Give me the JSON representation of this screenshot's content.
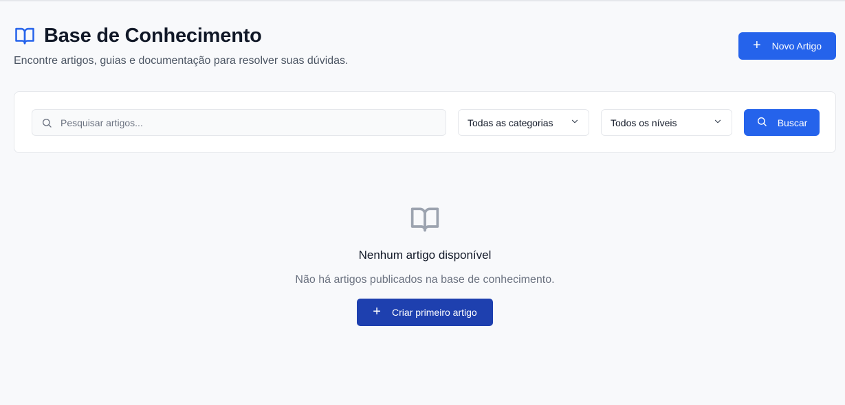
{
  "header": {
    "title": "Base de Conhecimento",
    "subtitle": "Encontre artigos, guias e documentação para resolver suas dúvidas.",
    "icon": "book-open-icon",
    "new_article_label": "Novo Artigo"
  },
  "filters": {
    "search_placeholder": "Pesquisar artigos...",
    "search_value": "",
    "category_selected": "Todas as categorias",
    "level_selected": "Todos os níveis",
    "search_button_label": "Buscar"
  },
  "empty_state": {
    "icon": "book-open-icon",
    "title": "Nenhum artigo disponível",
    "text": "Não há artigos publicados na base de conhecimento.",
    "create_label": "Criar primeiro artigo"
  },
  "colors": {
    "primary": "#2563eb",
    "primary_dark": "#1e40af",
    "background": "#f8f9fb",
    "muted_icon": "#9ca3af"
  }
}
